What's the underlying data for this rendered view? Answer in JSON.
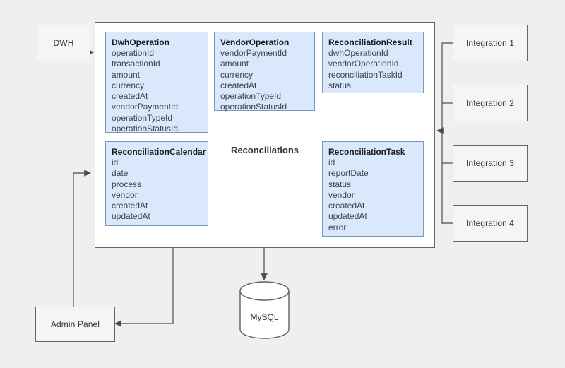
{
  "diagram": {
    "title": "Reconciliations",
    "colors": {
      "page_background": "#efefef",
      "entity_fill": "#dae8fc",
      "entity_stroke": "#7a96c2",
      "box_fill": "#f5f5f5",
      "box_stroke": "#666666",
      "container_fill": "#ffffff",
      "edge_stroke": "#666666",
      "text": "#333333"
    }
  },
  "external_nodes": {
    "dwh": {
      "label": "DWH"
    },
    "admin_panel": {
      "label": "Admin Panel"
    },
    "database": {
      "label": "MySQL",
      "shape": "cylinder"
    },
    "integrations": [
      {
        "label": "Integration 1"
      },
      {
        "label": "Integration 2"
      },
      {
        "label": "Integration 3"
      },
      {
        "label": "Integration 4"
      }
    ]
  },
  "entities": [
    {
      "name": "DwhOperation",
      "fields": [
        "operationId",
        "transactionId",
        "amount",
        "currency",
        "createdAt",
        "vendorPaymentId",
        "operationTypeId",
        "operationStatusId"
      ]
    },
    {
      "name": "VendorOperation",
      "fields": [
        "vendorPaymentId",
        "amount",
        "currency",
        "createdAt",
        "operationTypeId",
        "operationStatusId"
      ]
    },
    {
      "name": "ReconciliationResult",
      "fields": [
        "dwhOperationId",
        "vendorOperationId",
        "reconciliationTaskId",
        "status"
      ]
    },
    {
      "name": "ReconciliationCalendar",
      "fields": [
        "id",
        "date",
        "process",
        "vendor",
        "createdAt",
        "updatedAt"
      ]
    },
    {
      "name": "ReconciliationTask",
      "fields": [
        "id",
        "reportDate",
        "status",
        "vendor",
        "createdAt",
        "updatedAt",
        "error"
      ]
    }
  ]
}
